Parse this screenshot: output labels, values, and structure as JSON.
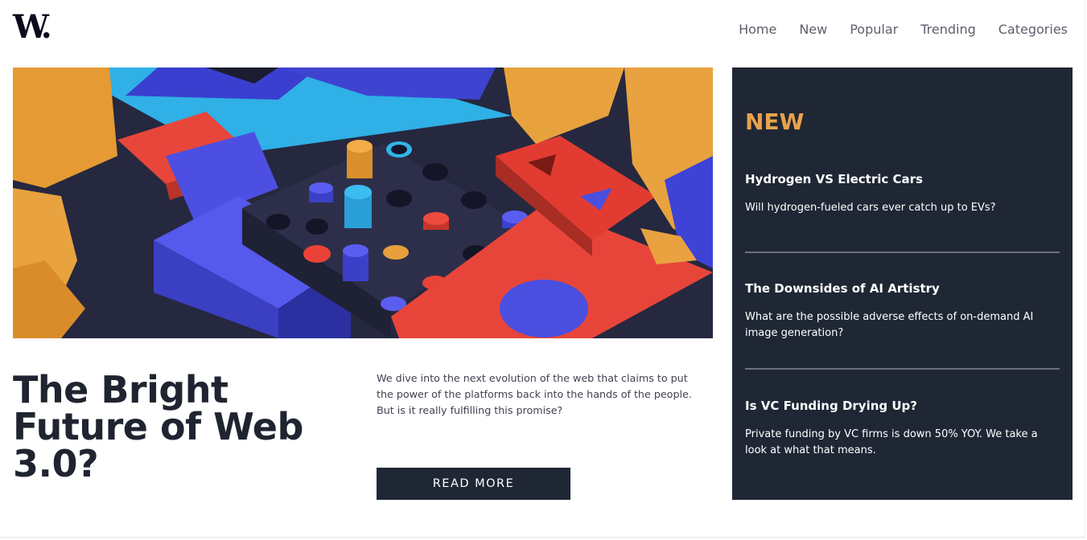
{
  "logo": {
    "text": "W."
  },
  "nav": {
    "items": [
      {
        "label": "Home"
      },
      {
        "label": "New"
      },
      {
        "label": "Popular"
      },
      {
        "label": "Trending"
      },
      {
        "label": "Categories"
      }
    ]
  },
  "hero": {
    "image_subject": "abstract 3D colorful geometric blocks",
    "colors": {
      "orange": "#e9a03a",
      "blue": "#4a4fe0",
      "red": "#ea4236",
      "cyan": "#2fb6ea",
      "dark": "#2b2d45"
    }
  },
  "article": {
    "headline": "The Bright Future of Web 3.0?",
    "description": "We dive into the next evolution of the web that claims to put the power of the platforms back into the hands of the people. But is it really fulfilling this promise?",
    "read_more_label": "READ MORE"
  },
  "sidebar": {
    "title": "NEW",
    "items": [
      {
        "title": "Hydrogen VS Electric Cars",
        "summary": "Will hydrogen-fueled cars ever catch up to EVs?"
      },
      {
        "title": "The Downsides of AI Artistry",
        "summary": "What are the possible adverse effects of on-demand AI image generation?"
      },
      {
        "title": "Is VC Funding Drying Up?",
        "summary": "Private funding by VC firms is down 50% YOY. We take a look at what that means."
      }
    ]
  },
  "colors": {
    "dark_navy": "#1f2735",
    "accent_orange": "#e9a24a",
    "text_dark": "#1f2430"
  }
}
